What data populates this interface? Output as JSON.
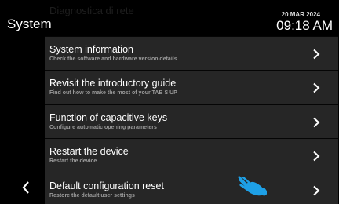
{
  "header": {
    "ghost_text": "Diagnostica di rete",
    "title": "System",
    "date": "20 MAR 2024",
    "time": "09:18 AM"
  },
  "items": [
    {
      "label": "System information",
      "desc": "Check the software and hardware version details"
    },
    {
      "label": "Revisit the introductory guide",
      "desc": "Find out how to make the most of your TAB S UP"
    },
    {
      "label": "Function of capacitive keys",
      "desc": "Configure automatic opening parameters"
    },
    {
      "label": "Restart the device",
      "desc": "Restart the device"
    },
    {
      "label": "Default configuration reset",
      "desc": "Restore the default user settings"
    }
  ],
  "icons": {
    "back": "chevron-left-icon",
    "row": "chevron-right-icon",
    "pointer": "hand-pointer-icon"
  },
  "colors": {
    "background": "#000000",
    "row_background": "#262626",
    "description": "#9b9b9b",
    "pointer": "#1ea0e6"
  }
}
